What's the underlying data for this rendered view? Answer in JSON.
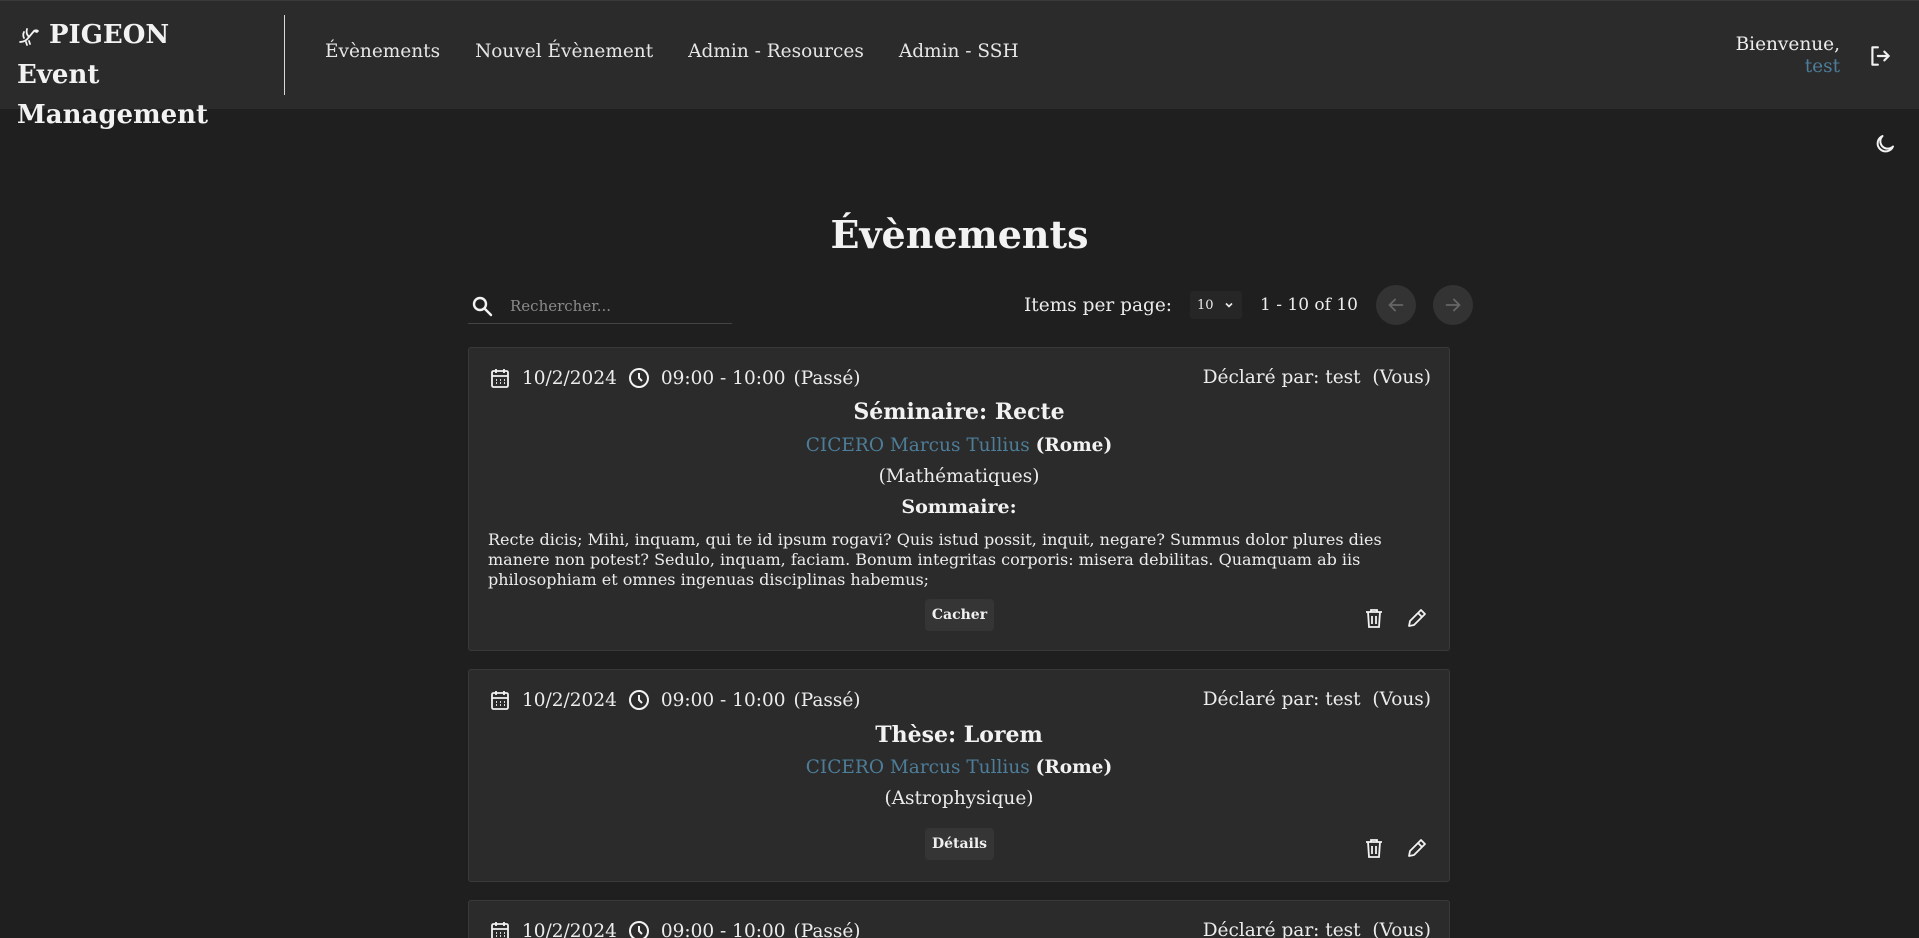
{
  "header": {
    "brand_line1": "PIGEON",
    "brand_line2": "Event Management",
    "nav": [
      "Évènements",
      "Nouvel Évènement",
      "Admin - Resources",
      "Admin - SSH"
    ],
    "welcome": "Bienvenue,",
    "username": "test"
  },
  "page": {
    "title": "Évènements",
    "search_placeholder": "Rechercher...",
    "items_per_page_label": "Items per page:",
    "items_per_page_value": "10",
    "range_label": "1 - 10 of 10"
  },
  "events": [
    {
      "date": "10/2/2024",
      "time": "09:00 - 10:00",
      "status": "(Passé)",
      "declared_by": "Déclaré par: test  (Vous)",
      "title": "Séminaire: Recte",
      "speaker_name": "CICERO Marcus Tullius",
      "speaker_place": "(Rome)",
      "department": "(Mathématiques)",
      "summary_heading": "Sommaire:",
      "summary": "Recte dicis; Mihi, inquam, qui te id ipsum rogavi? Quis istud possit, inquit, negare? Summus dolor plures dies manere non potest? Sedulo, inquam, faciam. Bonum integritas corporis: misera debilitas. Quamquam ab iis philosophiam et omnes ingenuas disciplinas habemus;",
      "toggle_label": "Cacher"
    },
    {
      "date": "10/2/2024",
      "time": "09:00 - 10:00",
      "status": "(Passé)",
      "declared_by": "Déclaré par: test  (Vous)",
      "title": "Thèse: Lorem",
      "speaker_name": "CICERO Marcus Tullius",
      "speaker_place": "(Rome)",
      "department": "(Astrophysique)",
      "toggle_label": "Détails"
    },
    {
      "date": "10/2/2024",
      "time": "09:00 - 10:00",
      "status": "(Passé)",
      "declared_by": "Déclaré par: test  (Vous)"
    }
  ]
}
